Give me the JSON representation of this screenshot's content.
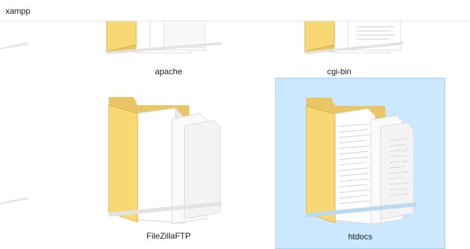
{
  "breadcrumb": {
    "path": "xampp"
  },
  "folders": [
    {
      "name": "apache",
      "selected": false
    },
    {
      "name": "cgi-bin",
      "selected": false
    },
    {
      "name": "FileZillaFTP",
      "selected": false
    },
    {
      "name": "htdocs",
      "selected": true
    }
  ],
  "colors": {
    "folder_back": "#e9c665",
    "folder_front": "#f8d775",
    "folder_edge": "#d8a93a",
    "paper": "#ffffff",
    "selection_fill": "#cce8ff",
    "selection_border": "#99d1ff"
  }
}
